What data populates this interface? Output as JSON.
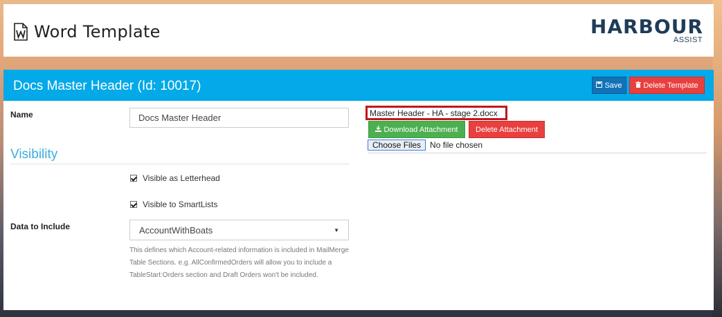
{
  "header": {
    "title": "Word Template",
    "logo_text": "HARBOUR",
    "logo_sub": "ASSIST",
    "icon": "word-document-icon"
  },
  "panel": {
    "title": "Docs Master Header (Id: 10017)",
    "save_label": "Save",
    "delete_template_label": "Delete Template"
  },
  "form": {
    "name_label": "Name",
    "name_value": "Docs Master Header",
    "visibility_heading": "Visibility",
    "visible_letterhead_label": "Visible as Letterhead",
    "visible_letterhead_checked": true,
    "visible_smartlists_label": "Visible to SmartLists",
    "visible_smartlists_checked": true,
    "data_label": "Data to Include",
    "data_value": "AccountWithBoats",
    "help_text": "This defines which Account-related information is included in MailMerge Table Sections. e.g. AllConfirmedOrders will allow you to include a TableStart:Orders section and Draft Orders won't be included."
  },
  "attachment": {
    "filename": "Master Header - HA - stage 2.docx",
    "download_label": "Download Attachment",
    "delete_label": "Delete Attachment",
    "choose_label": "Choose Files",
    "no_file_text": "No file chosen"
  },
  "colors": {
    "panel_header": "#03a9e8",
    "save_button": "#1172b8",
    "delete_button": "#e8403f",
    "download_button": "#4caf50",
    "heading_blue": "#3aaee0",
    "highlight_border": "#c0161c"
  }
}
